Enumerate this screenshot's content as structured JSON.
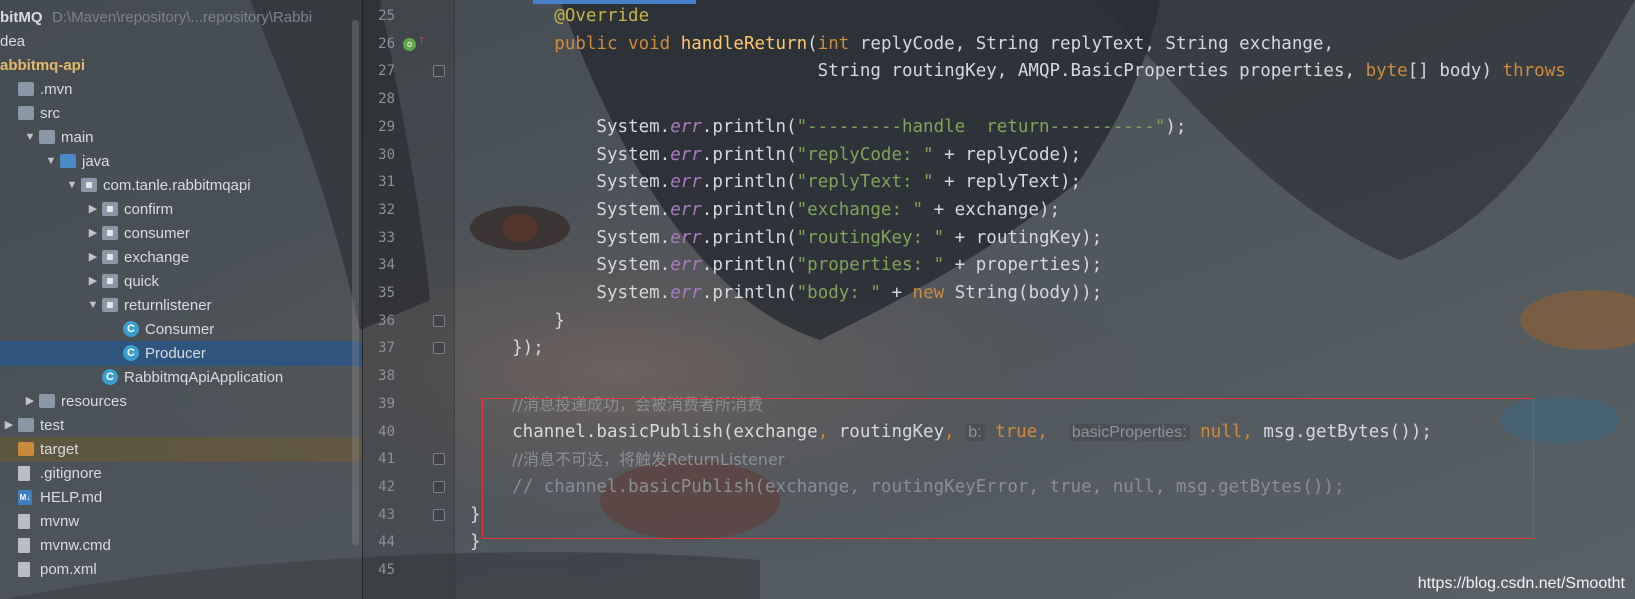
{
  "project_tree": [
    {
      "label": "bitMQ",
      "path_hint": "D:\\Maven\\repository\\...repository\\Rabbi",
      "indent": 0,
      "icon": "none",
      "expand": "",
      "bold": true
    },
    {
      "label": "dea",
      "indent": 0,
      "icon": "none",
      "expand": ""
    },
    {
      "label": "abbitmq-api",
      "indent": 0,
      "icon": "none",
      "expand": "",
      "bold": true,
      "module": true
    },
    {
      "label": ".mvn",
      "indent": 0,
      "icon": "folder",
      "expand": ""
    },
    {
      "label": "src",
      "indent": 0,
      "icon": "folder",
      "expand": ""
    },
    {
      "label": "main",
      "indent": 1,
      "icon": "folder",
      "expand": "▼"
    },
    {
      "label": "java",
      "indent": 2,
      "icon": "folder-blue",
      "expand": "▼"
    },
    {
      "label": "com.tanle.rabbitmqapi",
      "indent": 3,
      "icon": "pkg",
      "expand": "▼"
    },
    {
      "label": "confirm",
      "indent": 4,
      "icon": "pkg",
      "expand": "▶"
    },
    {
      "label": "consumer",
      "indent": 4,
      "icon": "pkg",
      "expand": "▶"
    },
    {
      "label": "exchange",
      "indent": 4,
      "icon": "pkg",
      "expand": "▶"
    },
    {
      "label": "quick",
      "indent": 4,
      "icon": "pkg",
      "expand": "▶"
    },
    {
      "label": "returnlistener",
      "indent": 4,
      "icon": "pkg",
      "expand": "▼"
    },
    {
      "label": "Consumer",
      "indent": 5,
      "icon": "class",
      "expand": ""
    },
    {
      "label": "Producer",
      "indent": 5,
      "icon": "class",
      "expand": "",
      "selected": true
    },
    {
      "label": "RabbitmqApiApplication",
      "indent": 4,
      "icon": "class",
      "expand": ""
    },
    {
      "label": "resources",
      "indent": 1,
      "icon": "folder",
      "expand": "▶"
    },
    {
      "label": "test",
      "indent": 0,
      "icon": "folder",
      "expand": "▶"
    },
    {
      "label": "target",
      "indent": 0,
      "icon": "folder-orange",
      "expand": "",
      "target": true
    },
    {
      "label": ".gitignore",
      "indent": 0,
      "icon": "file",
      "expand": ""
    },
    {
      "label": "HELP.md",
      "indent": 0,
      "icon": "md",
      "expand": ""
    },
    {
      "label": "mvnw",
      "indent": 0,
      "icon": "file",
      "expand": ""
    },
    {
      "label": "mvnw.cmd",
      "indent": 0,
      "icon": "file",
      "expand": ""
    },
    {
      "label": "pom.xml",
      "indent": 0,
      "icon": "file",
      "expand": ""
    }
  ],
  "line_numbers": [
    "25",
    "26",
    "27",
    "28",
    "29",
    "30",
    "31",
    "32",
    "33",
    "34",
    "35",
    "36",
    "37",
    "38",
    "39",
    "40",
    "41",
    "42",
    "43",
    "44",
    "45"
  ],
  "code_lines": [
    [
      {
        "t": "        ",
        "c": ""
      },
      {
        "t": "@Override",
        "c": "ann"
      }
    ],
    [
      {
        "t": "        ",
        "c": ""
      },
      {
        "t": "public void ",
        "c": "kw"
      },
      {
        "t": "handleReturn",
        "c": "fn"
      },
      {
        "t": "(",
        "c": ""
      },
      {
        "t": "int ",
        "c": "kw"
      },
      {
        "t": "replyCode, String replyText, String exchange,",
        "c": ""
      }
    ],
    [
      {
        "t": "                                 String routingKey, AMQP.BasicProperties properties, ",
        "c": ""
      },
      {
        "t": "byte",
        "c": "kw"
      },
      {
        "t": "[] body) ",
        "c": ""
      },
      {
        "t": "throws",
        "c": "kw"
      }
    ],
    [
      {
        "t": "",
        "c": ""
      }
    ],
    [
      {
        "t": "            System.",
        "c": ""
      },
      {
        "t": "err",
        "c": "fld"
      },
      {
        "t": ".println(",
        "c": ""
      },
      {
        "t": "\"---------handle  return----------\"",
        "c": "str"
      },
      {
        "t": ");",
        "c": ""
      }
    ],
    [
      {
        "t": "            System.",
        "c": ""
      },
      {
        "t": "err",
        "c": "fld"
      },
      {
        "t": ".println(",
        "c": ""
      },
      {
        "t": "\"replyCode: \"",
        "c": "str"
      },
      {
        "t": " + replyCode);",
        "c": ""
      }
    ],
    [
      {
        "t": "            System.",
        "c": ""
      },
      {
        "t": "err",
        "c": "fld"
      },
      {
        "t": ".println(",
        "c": ""
      },
      {
        "t": "\"replyText: \"",
        "c": "str"
      },
      {
        "t": " + replyText);",
        "c": ""
      }
    ],
    [
      {
        "t": "            System.",
        "c": ""
      },
      {
        "t": "err",
        "c": "fld"
      },
      {
        "t": ".println(",
        "c": ""
      },
      {
        "t": "\"exchange: \"",
        "c": "str"
      },
      {
        "t": " + exchange);",
        "c": ""
      }
    ],
    [
      {
        "t": "            System.",
        "c": ""
      },
      {
        "t": "err",
        "c": "fld"
      },
      {
        "t": ".println(",
        "c": ""
      },
      {
        "t": "\"routingKey: \"",
        "c": "str"
      },
      {
        "t": " + routingKey);",
        "c": ""
      }
    ],
    [
      {
        "t": "            System.",
        "c": ""
      },
      {
        "t": "err",
        "c": "fld"
      },
      {
        "t": ".println(",
        "c": ""
      },
      {
        "t": "\"properties: \"",
        "c": "str"
      },
      {
        "t": " + properties);",
        "c": ""
      }
    ],
    [
      {
        "t": "            System.",
        "c": ""
      },
      {
        "t": "err",
        "c": "fld"
      },
      {
        "t": ".println(",
        "c": ""
      },
      {
        "t": "\"body: \"",
        "c": "str"
      },
      {
        "t": " + ",
        "c": ""
      },
      {
        "t": "new ",
        "c": "kw"
      },
      {
        "t": "String(body));",
        "c": ""
      }
    ],
    [
      {
        "t": "        }",
        "c": ""
      }
    ],
    [
      {
        "t": "    });",
        "c": ""
      }
    ],
    [
      {
        "t": "",
        "c": ""
      }
    ],
    [
      {
        "t": "    ",
        "c": ""
      },
      {
        "t": "//消息投递成功，会被消费者所消费",
        "c": "cmt zh"
      }
    ],
    [
      {
        "t": "    channel.basicPublish(exchange",
        "c": ""
      },
      {
        "t": ", ",
        "c": "kw"
      },
      {
        "t": "routingKey",
        "c": ""
      },
      {
        "t": ", ",
        "c": "kw"
      },
      {
        "t": "b:",
        "c": "hint"
      },
      {
        "t": " ",
        "c": ""
      },
      {
        "t": "true",
        "c": "kw"
      },
      {
        "t": ",  ",
        "c": "kw"
      },
      {
        "t": "basicProperties:",
        "c": "hint"
      },
      {
        "t": " ",
        "c": ""
      },
      {
        "t": "null",
        "c": "kw"
      },
      {
        "t": ", ",
        "c": "kw"
      },
      {
        "t": "msg.getBytes());",
        "c": ""
      }
    ],
    [
      {
        "t": "    ",
        "c": ""
      },
      {
        "t": "//消息不可达，将触发ReturnListener",
        "c": "cmt zh"
      }
    ],
    [
      {
        "t": "    ",
        "c": ""
      },
      {
        "t": "// channel.basicPublish(exchange, routingKeyError, true, null, msg.getBytes());",
        "c": "cmt"
      }
    ],
    [
      {
        "t": "}",
        "c": ""
      }
    ],
    [
      {
        "t": "}",
        "c": ""
      }
    ],
    [
      {
        "t": "",
        "c": ""
      }
    ]
  ],
  "gutter": {
    "override_icon": "override-method-icon",
    "arrow_icon": "up-arrow-icon",
    "fold_lines": [
      "27",
      "36",
      "37",
      "41",
      "42",
      "43"
    ]
  },
  "watermark": "https://blog.csdn.net/Smootht",
  "colors": {
    "keyword": "#d08a3c",
    "string": "#7fa45a",
    "comment": "#8a8f95",
    "highlight_box": "#e23838"
  }
}
